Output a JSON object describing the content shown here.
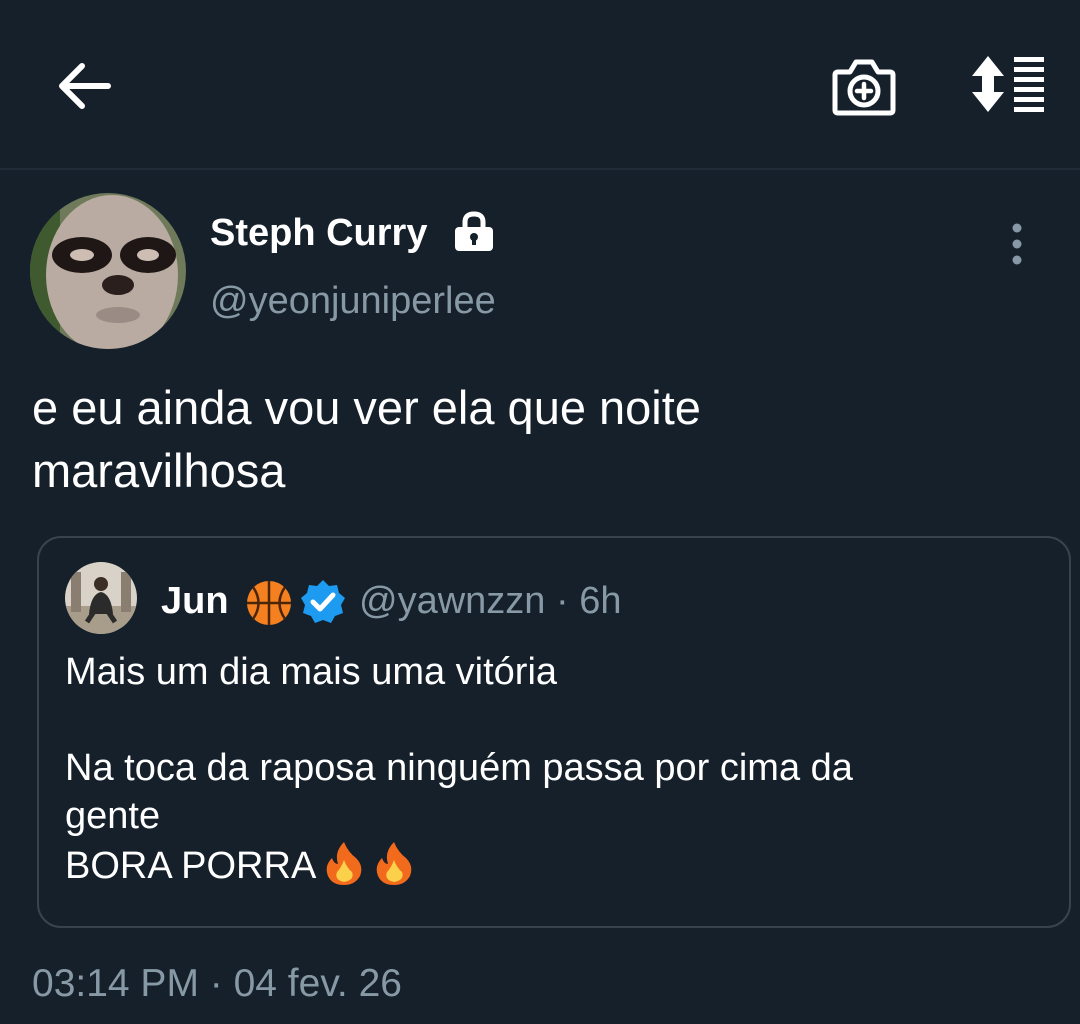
{
  "header": {
    "back_icon": "arrow-left-icon",
    "camera_icon": "camera-plus-icon",
    "sort_icon": "sort-list-icon"
  },
  "tweet": {
    "author": {
      "name": "Steph Curry",
      "handle": "@yeonjuniperlee",
      "protected_icon": "lock-icon"
    },
    "more_icon": "more-vertical-icon",
    "text": "e eu ainda vou ver ela que noite\nmaravilhosa",
    "quoted": {
      "name": "Jun",
      "handle": "@yawnzzn",
      "separator": "·",
      "time": "6h",
      "badges": [
        "basketball-icon",
        "verified-icon"
      ],
      "lines": [
        "Mais um dia mais uma vitória",
        "",
        "Na toca da raposa ninguém passa por cima da",
        "gente",
        "BORA PORRA"
      ],
      "emoji": [
        "fire-icon",
        "fire-icon"
      ]
    },
    "timestamp": "03:14 PM · 04 fev. 26"
  },
  "colors": {
    "background": "#15202b",
    "text": "#ffffff",
    "secondary": "#8899a6",
    "border": "#38444d",
    "verified": "#1d9bf0"
  }
}
